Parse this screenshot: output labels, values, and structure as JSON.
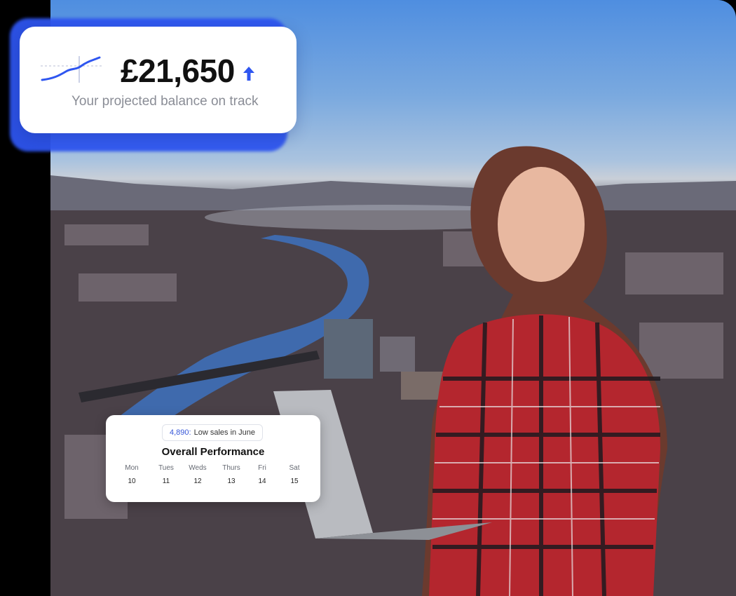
{
  "balance_card": {
    "amount": "£21,650",
    "caption": "Your projected balance on track",
    "trend": "up",
    "accent_color": "#2f56f0"
  },
  "performance_card": {
    "badge_value": "4,890:",
    "badge_text": "Low sales in June",
    "title": "Overall Performance",
    "days": [
      {
        "name": "Mon",
        "num": "10"
      },
      {
        "name": "Tues",
        "num": "11"
      },
      {
        "name": "Weds",
        "num": "12"
      },
      {
        "name": "Thurs",
        "num": "13"
      },
      {
        "name": "Fri",
        "num": "14"
      },
      {
        "name": "Sat",
        "num": "15"
      }
    ]
  },
  "icons": [
    "sparkline-icon",
    "arrow-up-icon"
  ],
  "colors": {
    "badge_number": "#3656d8",
    "caption": "#8a8d96"
  }
}
